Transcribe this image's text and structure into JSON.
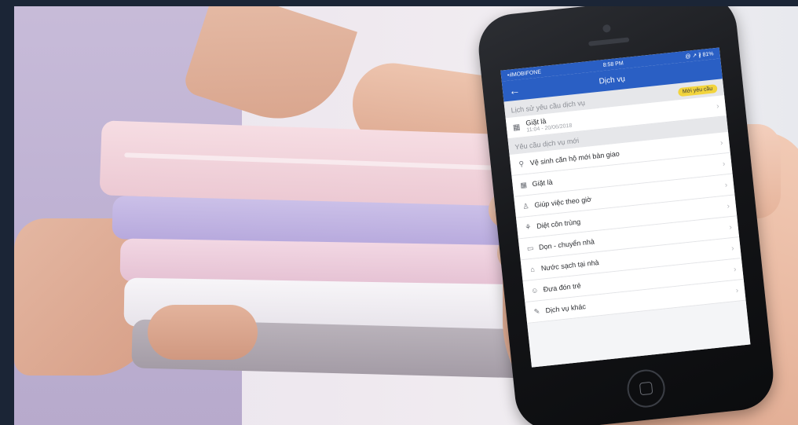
{
  "status_bar": {
    "carrier": "•ılMOBIFONE",
    "time": "8:58 PM",
    "indicators": "@ ↗ ∦ 81%"
  },
  "nav": {
    "back_icon": "arrow-left-icon",
    "title": "Dịch vụ"
  },
  "history": {
    "header": "Lịch sử yêu cầu dịch vụ",
    "badge": "Mới yêu cầu",
    "item_title": "Giặt là",
    "item_date": "11:04 - 20/06/2018"
  },
  "new_request": {
    "header": "Yêu cầu dịch vụ mới",
    "items": [
      {
        "label": "Vệ sinh căn hộ mới bàn giao",
        "icon": "⚲"
      },
      {
        "label": "Giặt là",
        "icon": "▦"
      },
      {
        "label": "Giúp việc theo giờ",
        "icon": "♙"
      },
      {
        "label": "Diệt côn trùng",
        "icon": "⚘"
      },
      {
        "label": "Dọn - chuyển nhà",
        "icon": "▭"
      },
      {
        "label": "Nước sạch tại nhà",
        "icon": "⌂"
      },
      {
        "label": "Đưa đón trẻ",
        "icon": "☺"
      },
      {
        "label": "Dịch vụ khác",
        "icon": "✎"
      }
    ]
  },
  "colors": {
    "header_blue": "#2a5fc4",
    "badge_yellow": "#f2d43d",
    "page_background": "#1b2536"
  }
}
